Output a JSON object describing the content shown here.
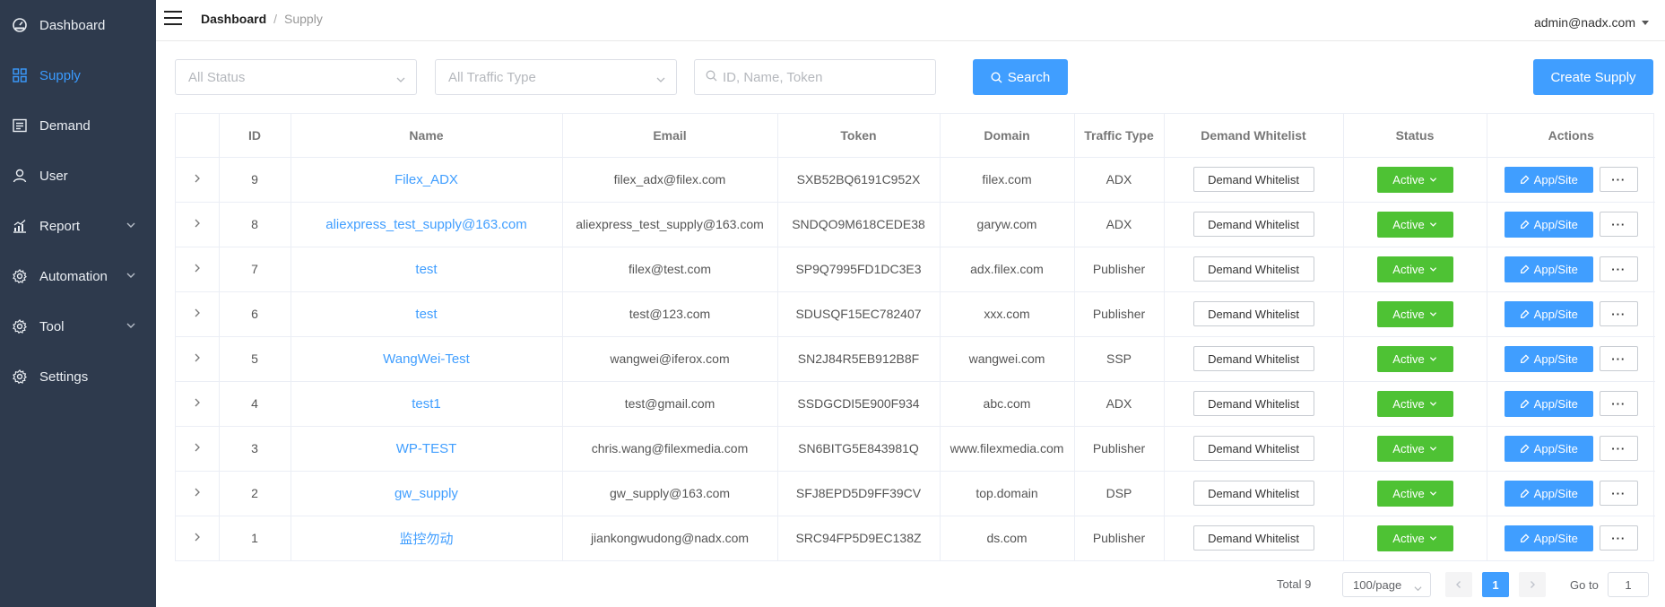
{
  "sidebar": {
    "items": [
      {
        "label": "Dashboard",
        "icon": "dashboard-icon"
      },
      {
        "label": "Supply",
        "icon": "grid-icon",
        "active": true
      },
      {
        "label": "Demand",
        "icon": "list-icon"
      },
      {
        "label": "User",
        "icon": "user-icon"
      },
      {
        "label": "Report",
        "icon": "chart-icon",
        "has_submenu": true
      },
      {
        "label": "Automation",
        "icon": "gear-icon",
        "has_submenu": true
      },
      {
        "label": "Tool",
        "icon": "gear-icon",
        "has_submenu": true
      },
      {
        "label": "Settings",
        "icon": "gear-icon"
      }
    ]
  },
  "header": {
    "breadcrumb_home": "Dashboard",
    "breadcrumb_sep": "/",
    "breadcrumb_current": "Supply",
    "user_email": "admin@nadx.com"
  },
  "filters": {
    "status_placeholder": "All Status",
    "traffic_placeholder": "All Traffic Type",
    "search_placeholder": "ID, Name, Token",
    "search_button": "Search",
    "create_button": "Create Supply"
  },
  "table": {
    "columns": [
      "",
      "ID",
      "Name",
      "Email",
      "Token",
      "Domain",
      "Traffic Type",
      "Demand Whitelist",
      "Status",
      "Actions"
    ],
    "whitelist_label": "Demand Whitelist",
    "app_label": "App/Site",
    "more_label": "···",
    "rows": [
      {
        "id": "9",
        "name": "Filex_ADX",
        "email": "filex_adx@filex.com",
        "token": "SXB52BQ6191C952X",
        "domain": "filex.com",
        "traffic": "ADX",
        "status": "Active"
      },
      {
        "id": "8",
        "name": "aliexpress_test_supply@163.com",
        "email": "aliexpress_test_supply@163.com",
        "token": "SNDQO9M618CEDE38",
        "domain": "garyw.com",
        "traffic": "ADX",
        "status": "Active"
      },
      {
        "id": "7",
        "name": "test",
        "email": "filex@test.com",
        "token": "SP9Q7995FD1DC3E3",
        "domain": "adx.filex.com",
        "traffic": "Publisher",
        "status": "Active"
      },
      {
        "id": "6",
        "name": "test",
        "email": "test@123.com",
        "token": "SDUSQF15EC782407",
        "domain": "xxx.com",
        "traffic": "Publisher",
        "status": "Active"
      },
      {
        "id": "5",
        "name": "WangWei-Test",
        "email": "wangwei@iferox.com",
        "token": "SN2J84R5EB912B8F",
        "domain": "wangwei.com",
        "traffic": "SSP",
        "status": "Active"
      },
      {
        "id": "4",
        "name": "test1",
        "email": "test@gmail.com",
        "token": "SSDGCDI5E900F934",
        "domain": "abc.com",
        "traffic": "ADX",
        "status": "Active"
      },
      {
        "id": "3",
        "name": "WP-TEST",
        "email": "chris.wang@filexmedia.com",
        "token": "SN6BITG5E843981Q",
        "domain": "www.filexmedia.com",
        "traffic": "Publisher",
        "status": "Active"
      },
      {
        "id": "2",
        "name": "gw_supply",
        "email": "gw_supply@163.com",
        "token": "SFJ8EPD5D9FF39CV",
        "domain": "top.domain",
        "traffic": "DSP",
        "status": "Active"
      },
      {
        "id": "1",
        "name": "监控勿动",
        "email": "jiankongwudong@nadx.com",
        "token": "SRC94FP5D9EC138Z",
        "domain": "ds.com",
        "traffic": "Publisher",
        "status": "Active"
      }
    ]
  },
  "pagination": {
    "total": "Total 9",
    "page_size": "100/page",
    "current_page": "1",
    "goto_label": "Go to",
    "goto_value": "1"
  },
  "colors": {
    "sidebar_bg": "#2e3a4d",
    "primary": "#409eff",
    "active_green": "#4ec234"
  }
}
